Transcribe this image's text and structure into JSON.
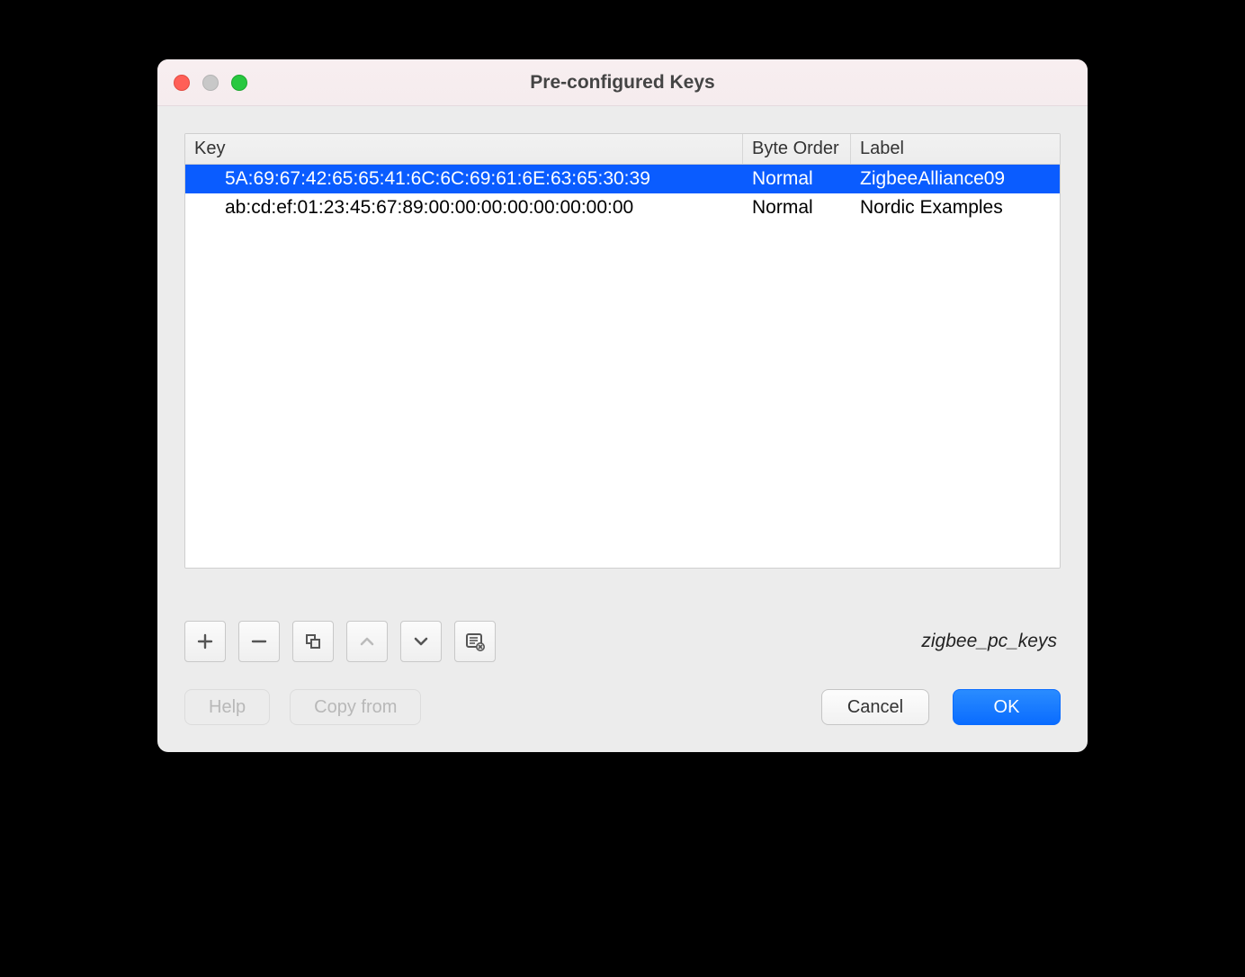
{
  "window": {
    "title": "Pre-configured Keys"
  },
  "table": {
    "headers": {
      "key": "Key",
      "order": "Byte Order",
      "label": "Label"
    },
    "rows": [
      {
        "key": "5A:69:67:42:65:65:41:6C:6C:69:61:6E:63:65:30:39",
        "order": "Normal",
        "label": "ZigbeeAlliance09",
        "selected": true
      },
      {
        "key": "ab:cd:ef:01:23:45:67:89:00:00:00:00:00:00:00:00",
        "order": "Normal",
        "label": "Nordic Examples",
        "selected": false
      }
    ]
  },
  "profile_name": "zigbee_pc_keys",
  "buttons": {
    "help": "Help",
    "copy_from": "Copy from",
    "cancel": "Cancel",
    "ok": "OK"
  }
}
